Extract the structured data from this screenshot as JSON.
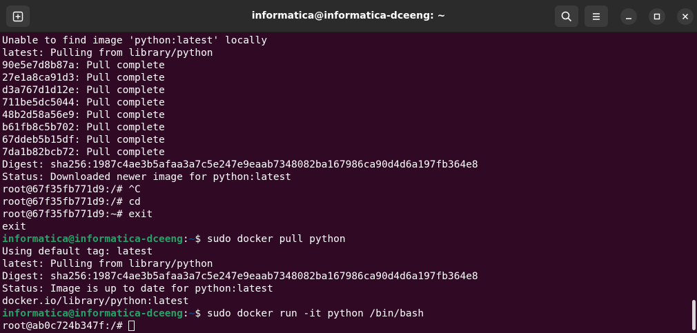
{
  "window": {
    "title": "informatica@informatica-dceeng: ~"
  },
  "icons": {
    "new_tab": "new-tab-icon",
    "search": "search-icon",
    "menu": "hamburger-menu-icon",
    "minimize": "minimize-icon",
    "maximize": "maximize-icon",
    "close": "close-icon"
  },
  "colors": {
    "terminal_bg": "#300a24",
    "titlebar_bg": "#2b2b2b",
    "prompt_user": "#26a269",
    "prompt_path": "#12488b",
    "text": "#ffffff"
  },
  "terminal": {
    "lines": [
      "Unable to find image 'python:latest' locally",
      "latest: Pulling from library/python",
      "90e5e7d8b87a: Pull complete",
      "27e1a8ca91d3: Pull complete",
      "d3a767d1d12e: Pull complete",
      "711be5dc5044: Pull complete",
      "48b2d58a56e9: Pull complete",
      "b61fb8c5b702: Pull complete",
      "67ddeb5b15df: Pull complete",
      "7da1b82bcb72: Pull complete",
      "Digest: sha256:1987c4ae3b5afaa3a7c5e247e9eaab7348082ba167986ca90d4d6a197fb364e8",
      "Status: Downloaded newer image for python:latest",
      "root@67f35fb771d9:/# ^C",
      "root@67f35fb771d9:/# cd",
      "root@67f35fb771d9:~# exit",
      "exit"
    ],
    "prompt1": {
      "user": "informatica@informatica-dceeng",
      "colon": ":",
      "path": "~",
      "dollar": "$ ",
      "cmd": "sudo docker pull python"
    },
    "lines2": [
      "Using default tag: latest",
      "latest: Pulling from library/python",
      "Digest: sha256:1987c4ae3b5afaa3a7c5e247e9eaab7348082ba167986ca90d4d6a197fb364e8",
      "Status: Image is up to date for python:latest",
      "docker.io/library/python:latest"
    ],
    "prompt2": {
      "user": "informatica@informatica-dceeng",
      "colon": ":",
      "path": "~",
      "dollar": "$ ",
      "cmd": "sudo docker run -it python /bin/bash"
    },
    "last_prompt": "root@ab0c724b347f:/# "
  }
}
